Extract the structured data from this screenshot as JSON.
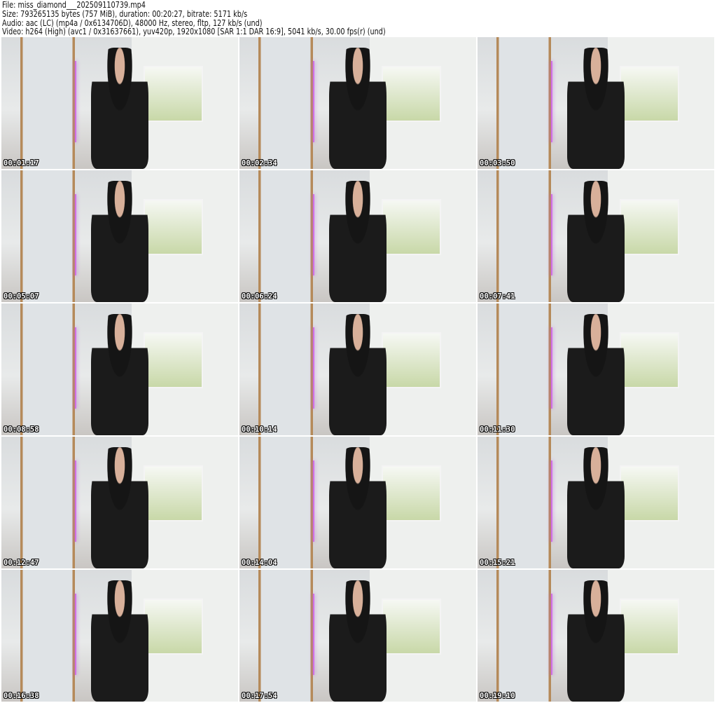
{
  "info": {
    "file": "File: miss_diamond___202509110739.mp4",
    "size": "Size: 793265135 bytes (757 MiB), duration: 00:20:27, bitrate: 5171 kb/s",
    "audio": "Audio: aac (LC) (mp4a / 0x6134706D), 48000 Hz, stereo, fltp, 127 kb/s (und)",
    "video": "Video: h264 (High) (avc1 / 0x31637661), yuv420p, 1920x1080 [SAR 1:1 DAR 16:9], 5041 kb/s, 30.00 fps(r) (und)"
  },
  "thumbnails": [
    {
      "timestamp": "00:01:17"
    },
    {
      "timestamp": "00:02:34"
    },
    {
      "timestamp": "00:03:50"
    },
    {
      "timestamp": "00:05:07"
    },
    {
      "timestamp": "00:06:24"
    },
    {
      "timestamp": "00:07:41"
    },
    {
      "timestamp": "00:08:58"
    },
    {
      "timestamp": "00:10:14"
    },
    {
      "timestamp": "00:11:30"
    },
    {
      "timestamp": "00:12:47"
    },
    {
      "timestamp": "00:14:04"
    },
    {
      "timestamp": "00:15:21"
    },
    {
      "timestamp": "00:16:38"
    },
    {
      "timestamp": "00:17:54"
    },
    {
      "timestamp": "00:19:10"
    }
  ]
}
